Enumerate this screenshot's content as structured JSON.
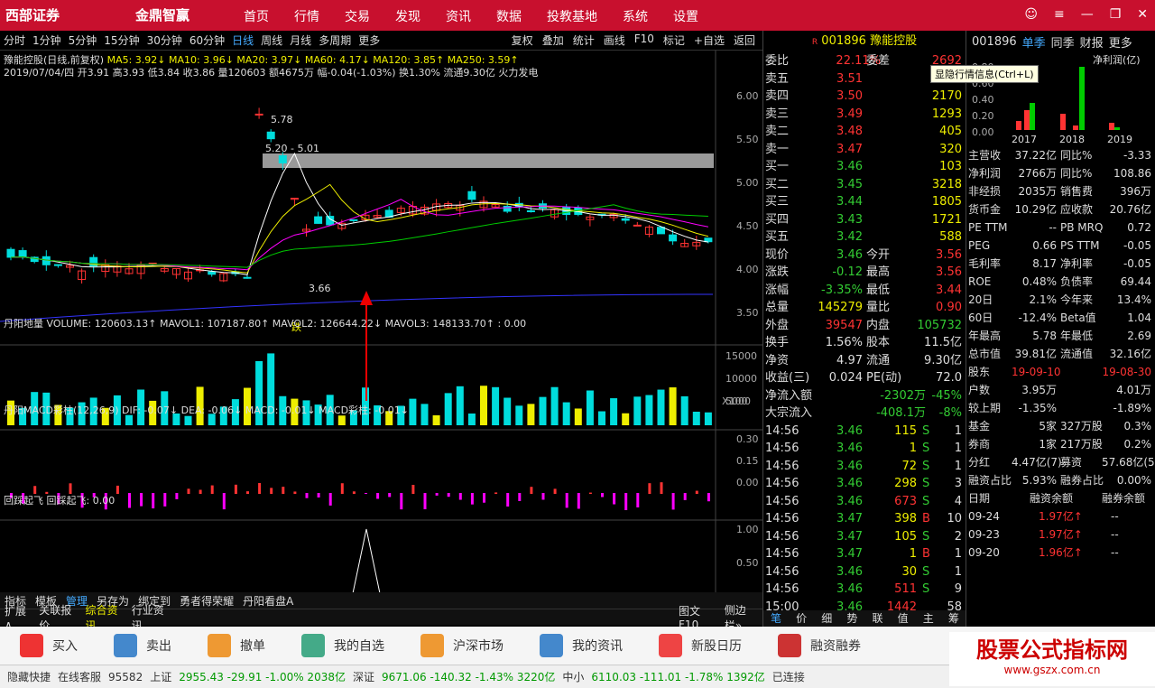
{
  "topbar": {
    "logo": "西部证券",
    "logo2": "金鼎智赢",
    "nav": [
      "首页",
      "行情",
      "交易",
      "发现",
      "资讯",
      "数据",
      "投教基地",
      "系统",
      "设置"
    ]
  },
  "tabs": {
    "left": [
      "分时",
      "1分钟",
      "5分钟",
      "15分钟",
      "30分钟",
      "60分钟",
      "日线",
      "周线",
      "月线",
      "多周期",
      "更多"
    ],
    "right": [
      "复权",
      "叠加",
      "统计",
      "画线",
      "F10",
      "标记",
      "+自选",
      "返回"
    ]
  },
  "info": {
    "title": "豫能控股(日线,前复权)",
    "ma": "MA5: 3.92↓  MA10: 3.96↓  MA20: 3.97↓  MA60: 4.17↓  MA120: 3.85↑  MA250: 3.59↑",
    "ohlc": "2019/07/04/四 开3.91 高3.93 低3.84 收3.86 量120603 额4675万 幅-0.04(-1.03%) 换1.30% 流通9.30亿 火力发电"
  },
  "yaxis_main": [
    "6.00",
    "5.50",
    "5.00",
    "4.50",
    "4.00",
    "3.50"
  ],
  "annot": {
    "high": "5.78",
    "range": "5.20 - 5.01",
    "low": "3.66",
    "die": "跌"
  },
  "vol": {
    "info": "丹阳地量  VOLUME: 120603.13↑  MAVOL1: 107187.80↑  MAVOL2: 126644.22↓  MAVOL3: 148133.70↑   : 0.00",
    "axis": [
      "15000",
      "10000",
      "5000",
      "X100"
    ]
  },
  "macd": {
    "info": "丹阳MACD彩柱(12,26,9)  DIF: -0.07↓  DEA: -0.06↓  MACD: -0.01↓  MACD彩柱: -0.01↓",
    "axis": [
      "0.30",
      "0.15",
      "0.00"
    ]
  },
  "hs": {
    "info": "回踩起飞  回踩起飞: 0.00",
    "axis": [
      "1.00",
      "0.50",
      "0.00"
    ]
  },
  "xaxis": [
    "2019年",
    "4",
    "5",
    "6",
    "2019/07/04/四",
    "日线"
  ],
  "lbtm1": [
    "指标",
    "模板",
    "管理",
    "另存为",
    "绑定到",
    "勇者得荣耀",
    "丹阳看盘A"
  ],
  "lbtm2": [
    "扩展∧",
    "关联报价",
    "综合资讯",
    "行业资讯",
    "图文F10",
    "侧边栏»"
  ],
  "stock": {
    "code": "001896",
    "name": "豫能控股",
    "weibi": "22.11%",
    "weicha": "2692",
    "sell": [
      [
        "卖五",
        "3.51",
        "555"
      ],
      [
        "卖四",
        "3.50",
        "2170"
      ],
      [
        "卖三",
        "3.49",
        "1293"
      ],
      [
        "卖二",
        "3.48",
        "405"
      ],
      [
        "卖一",
        "3.47",
        "320"
      ]
    ],
    "buy": [
      [
        "买一",
        "3.46",
        "103"
      ],
      [
        "买二",
        "3.45",
        "3218"
      ],
      [
        "买三",
        "3.44",
        "1805"
      ],
      [
        "买四",
        "3.43",
        "1721"
      ],
      [
        "买五",
        "3.42",
        "588"
      ]
    ],
    "quote": [
      [
        "现价",
        "3.46",
        "今开",
        "3.56"
      ],
      [
        "涨跌",
        "-0.12",
        "最高",
        "3.56"
      ],
      [
        "涨幅",
        "-3.35%",
        "最低",
        "3.44"
      ],
      [
        "总量",
        "145279",
        "量比",
        "0.90"
      ],
      [
        "外盘",
        "39547",
        "内盘",
        "105732"
      ]
    ],
    "fin": [
      [
        "换手",
        "1.56%",
        "股本",
        "11.5亿"
      ],
      [
        "净资",
        "4.97",
        "流通",
        "9.30亿"
      ],
      [
        "收益(三)",
        "0.024",
        "PE(动)",
        "72.0"
      ]
    ],
    "flow": [
      [
        "净流入额",
        "-2302万",
        "-45%"
      ],
      [
        "大宗流入",
        "-408.1万",
        "-8%"
      ]
    ],
    "ticks": [
      [
        "14:56",
        "3.46",
        "115",
        "S",
        "1"
      ],
      [
        "14:56",
        "3.46",
        "1",
        "S",
        "1"
      ],
      [
        "14:56",
        "3.46",
        "72",
        "S",
        "1"
      ],
      [
        "14:56",
        "3.46",
        "298",
        "S",
        "3"
      ],
      [
        "14:56",
        "3.46",
        "673",
        "S",
        "4"
      ],
      [
        "14:56",
        "3.47",
        "398",
        "B",
        "10"
      ],
      [
        "14:56",
        "3.47",
        "105",
        "S",
        "2"
      ],
      [
        "14:56",
        "3.47",
        "1",
        "B",
        "1"
      ],
      [
        "14:56",
        "3.46",
        "30",
        "S",
        "1"
      ],
      [
        "14:56",
        "3.46",
        "511",
        "S",
        "9"
      ],
      [
        "15:00",
        "3.46",
        "1442",
        "",
        "58"
      ]
    ],
    "rtabs": [
      "笔",
      "价",
      "细",
      "势",
      "联",
      "值",
      "主",
      "筹"
    ]
  },
  "f10": {
    "hdr": [
      "001896",
      "单季",
      "同季",
      "财报",
      "更多"
    ],
    "tooltip": "显隐行情信息(Ctrl+L)",
    "title": "净利润(亿)",
    "yrs": [
      "2017",
      "2018",
      "2019"
    ],
    "ax": [
      "0.00",
      "0.20",
      "0.40",
      "0.60",
      "0.80"
    ],
    "rows": [
      [
        "主营收",
        "37.22亿",
        "同比%",
        "-3.33"
      ],
      [
        "净利润",
        "2766万",
        "同比%",
        "108.86"
      ],
      [
        "非经损",
        "2035万",
        "销售费",
        "396万"
      ],
      [
        "货币金",
        "10.29亿",
        "应收款",
        "20.76亿"
      ],
      [
        "PE TTM",
        "--",
        "PB MRQ",
        "0.72"
      ],
      [
        "PEG",
        "0.66",
        "PS TTM",
        "-0.05"
      ],
      [
        "毛利率",
        "8.17",
        "净利率",
        "-0.05"
      ],
      [
        "ROE",
        "0.48%",
        "负债率",
        "69.44"
      ],
      [
        "20日",
        "2.1%",
        "今年来",
        "13.4%"
      ],
      [
        "60日",
        "-12.4%",
        "Beta值",
        "1.04"
      ],
      [
        "年最高",
        "5.78",
        "年最低",
        "2.69"
      ],
      [
        "总市值",
        "39.81亿",
        "流通值",
        "32.16亿"
      ],
      [
        "股东",
        "19-09-10",
        "",
        "19-08-30"
      ],
      [
        "户数",
        "3.95万",
        "",
        "4.01万"
      ],
      [
        "较上期",
        "-1.35%",
        "",
        "-1.89%"
      ],
      [
        "基金",
        "5家",
        "327万股",
        "0.3%"
      ],
      [
        "券商",
        "1家",
        "217万股",
        "0.2%"
      ],
      [
        "分红",
        "4.47亿(7)",
        "募资",
        "57.68亿(5)"
      ],
      [
        "融资占比",
        "5.93%",
        "融券占比",
        "0.00%"
      ]
    ],
    "margin_hdr": [
      "日期",
      "融资余额",
      "融券余额"
    ],
    "margin": [
      [
        "09-24",
        "1.97亿↑",
        "--"
      ],
      [
        "09-23",
        "1.97亿↑",
        "--"
      ],
      [
        "09-20",
        "1.96亿↑",
        "--"
      ]
    ]
  },
  "bottom": [
    "买入",
    "卖出",
    "撤单",
    "我的自选",
    "沪深市场",
    "我的资讯",
    "新股日历",
    "融资融券"
  ],
  "status": {
    "hide": "隐藏快捷",
    "online": "在线客服",
    "tel": "95582",
    "sh": "上证",
    "shv": "2955.43 -29.91 -1.00% 2038亿",
    "sz": "深证",
    "szv": "9671.06 -140.32 -1.43% 3220亿",
    "zx": "中小",
    "zxv": "6110.03 -111.01 -1.78% 1392亿",
    "conn": "已连接"
  },
  "brand": {
    "t1": "股票公式指标网",
    "t2": "www.gszx.com.cn"
  }
}
